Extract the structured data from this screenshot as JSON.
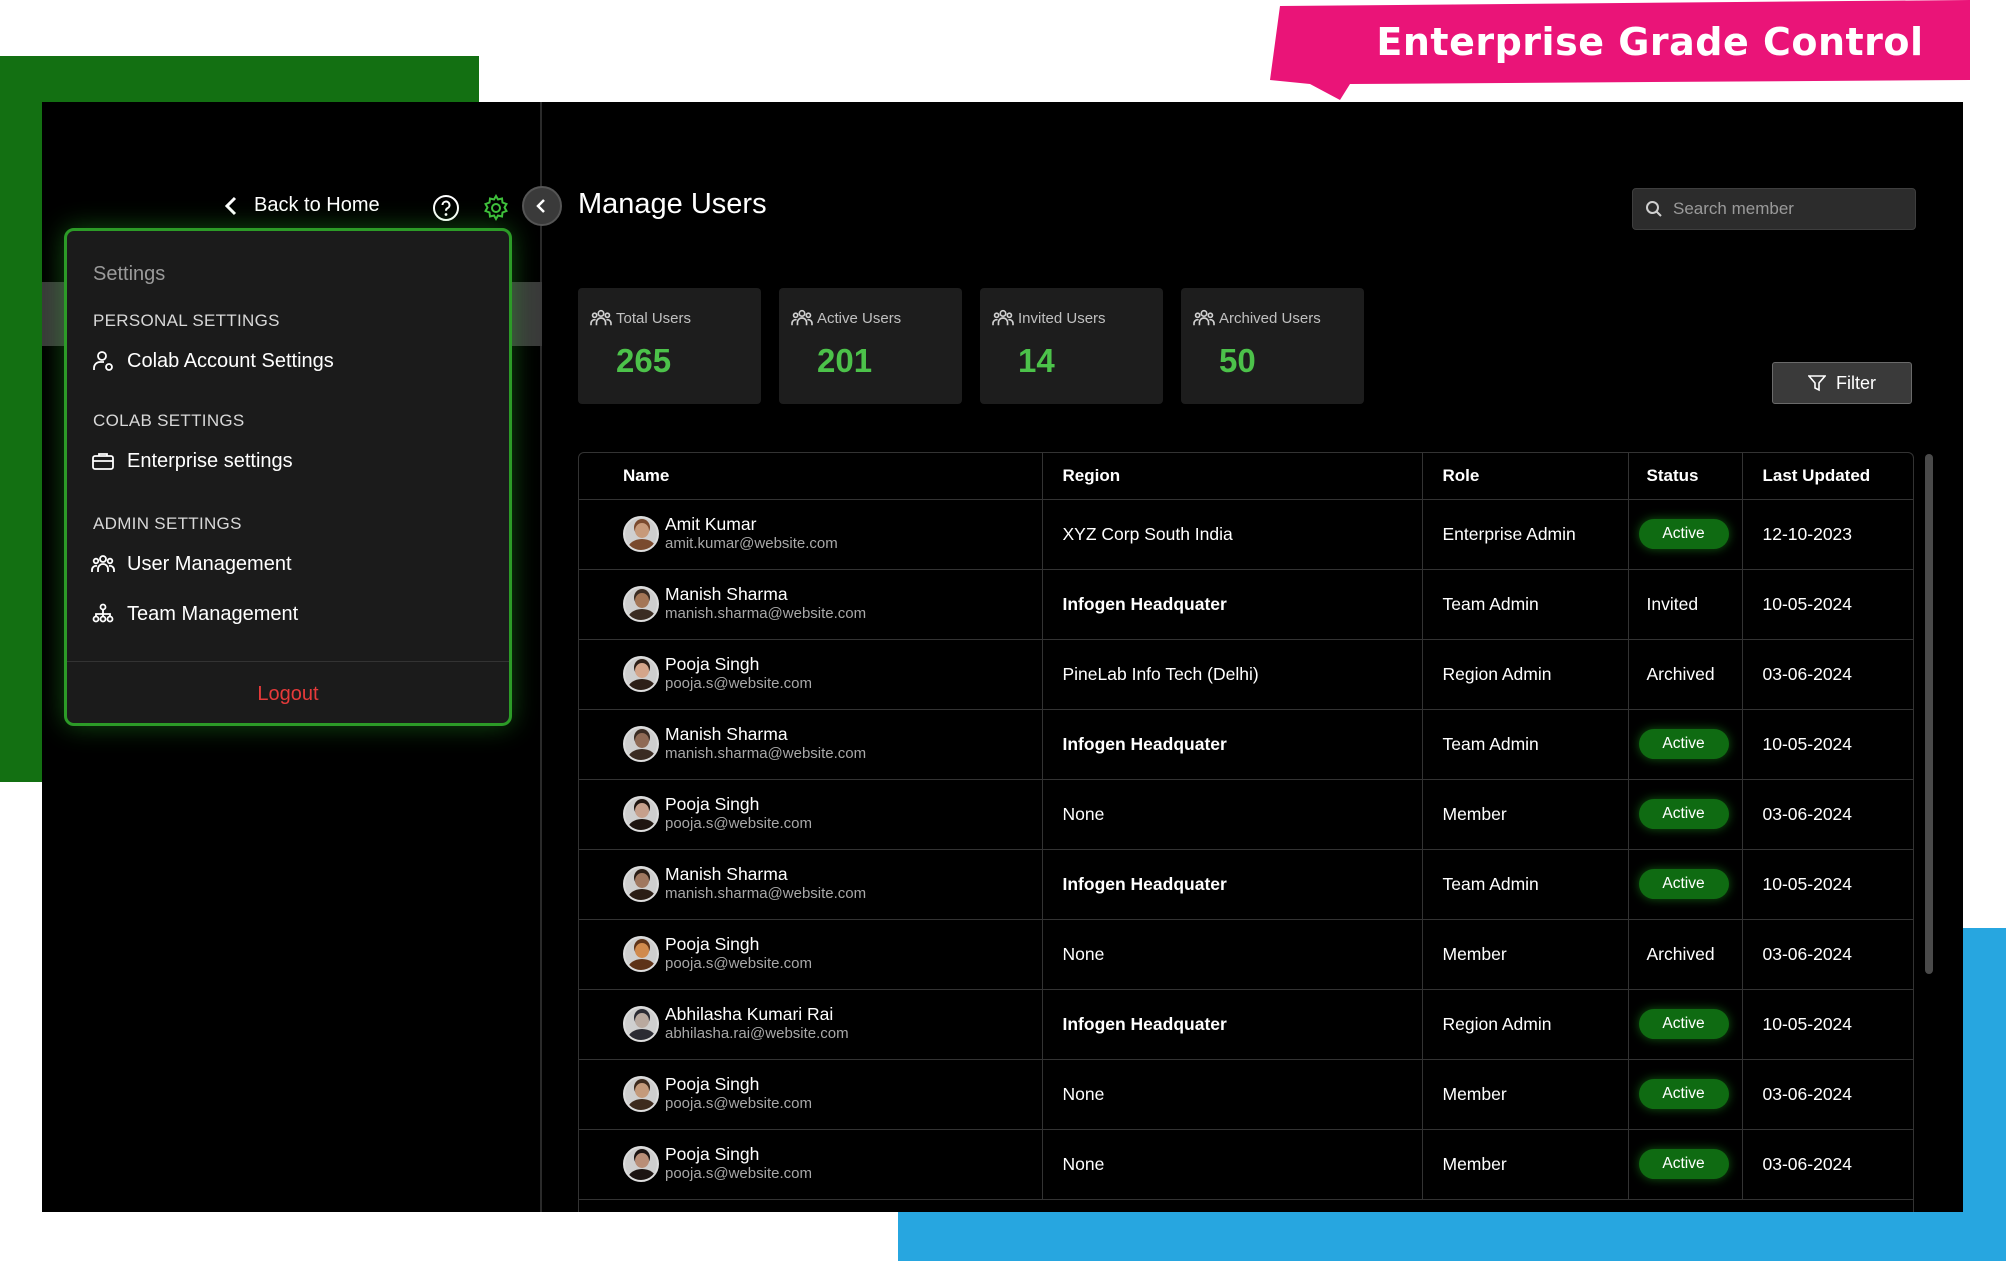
{
  "banner": {
    "text": "Enterprise Grade Control"
  },
  "colors": {
    "accent_green": "#4cc24a",
    "badge_green": "#0f6b12",
    "logout_red": "#e63a3a",
    "banner_pink": "#ea1478",
    "deco_green": "#137012",
    "deco_blue": "#27a6e0"
  },
  "sidebar": {
    "back_label": "Back to Home",
    "menu": {
      "title": "Settings",
      "personal_heading": "PERSONAL SETTINGS",
      "colab_account": "Colab Account Settings",
      "colab_heading": "COLAB SETTINGS",
      "enterprise": "Enterprise settings",
      "admin_heading": "ADMIN SETTINGS",
      "user_mgmt": "User Management",
      "team_mgmt": "Team Management",
      "logout": "Logout"
    }
  },
  "main": {
    "title": "Manage Users",
    "search_placeholder": "Search member",
    "filter_label": "Filter",
    "stats": [
      {
        "label": "Total Users",
        "value": "265"
      },
      {
        "label": "Active Users",
        "value": "201"
      },
      {
        "label": "Invited Users",
        "value": "14"
      },
      {
        "label": "Archived Users",
        "value": "50"
      }
    ],
    "columns": [
      "Name",
      "Region",
      "Role",
      "Status",
      "Last Updated"
    ],
    "rows": [
      {
        "name": "Amit Kumar",
        "email": "amit.kumar@website.com",
        "region": "XYZ Corp South India",
        "role": "Enterprise Admin",
        "status": "Active",
        "updated": "12-10-2023"
      },
      {
        "name": "Manish Sharma",
        "email": "manish.sharma@website.com",
        "region": "Infogen Headquater",
        "role": "Team Admin",
        "status": "Invited",
        "updated": "10-05-2024"
      },
      {
        "name": "Pooja Singh",
        "email": "pooja.s@website.com",
        "region": "PineLab Info Tech (Delhi)",
        "role": "Region Admin",
        "status": "Archived",
        "updated": "03-06-2024"
      },
      {
        "name": "Manish Sharma",
        "email": "manish.sharma@website.com",
        "region": "Infogen Headquater",
        "role": "Team Admin",
        "status": "Active",
        "updated": "10-05-2024"
      },
      {
        "name": "Pooja Singh",
        "email": "pooja.s@website.com",
        "region": "None",
        "role": "Member",
        "status": "Active",
        "updated": "03-06-2024"
      },
      {
        "name": "Manish Sharma",
        "email": "manish.sharma@website.com",
        "region": "Infogen Headquater",
        "role": "Team Admin",
        "status": "Active",
        "updated": "10-05-2024"
      },
      {
        "name": "Pooja Singh",
        "email": "pooja.s@website.com",
        "region": "None",
        "role": "Member",
        "status": "Archived",
        "updated": "03-06-2024"
      },
      {
        "name": "Abhilasha Kumari Rai",
        "email": "abhilasha.rai@website.com",
        "region": "Infogen Headquater",
        "role": "Region Admin",
        "status": "Active",
        "updated": "10-05-2024"
      },
      {
        "name": "Pooja Singh",
        "email": "pooja.s@website.com",
        "region": "None",
        "role": "Member",
        "status": "Active",
        "updated": "03-06-2024"
      },
      {
        "name": "Pooja Singh",
        "email": "pooja.s@website.com",
        "region": "None",
        "role": "Member",
        "status": "Active",
        "updated": "03-06-2024"
      }
    ]
  }
}
